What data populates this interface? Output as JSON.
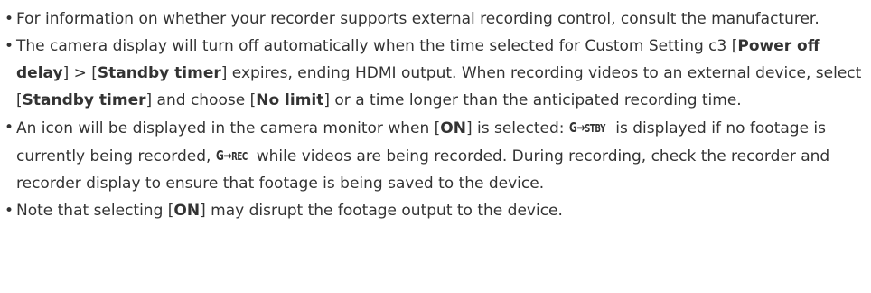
{
  "notes": [
    {
      "segments": [
        {
          "text": "For information on whether your recorder supports external recording control, consult the manufacturer."
        }
      ]
    },
    {
      "segments": [
        {
          "text": "The camera display will turn off automatically when the time selected for Custom Setting c3 ["
        },
        {
          "text": "Power off delay",
          "bold": true
        },
        {
          "text": "] > ["
        },
        {
          "text": "Standby timer",
          "bold": true
        },
        {
          "text": "] expires, ending HDMI output. When recording videos to an external device, select ["
        },
        {
          "text": "Standby timer",
          "bold": true
        },
        {
          "text": "] and choose ["
        },
        {
          "text": "No limit",
          "bold": true
        },
        {
          "text": "] or a time longer than the anticipated recording time."
        }
      ]
    },
    {
      "segments": [
        {
          "text": "An icon will be displayed in the camera monitor when ["
        },
        {
          "text": "ON",
          "bold": true
        },
        {
          "text": "] is selected: "
        },
        {
          "icon": "hdmi-standby-icon",
          "label": "STBY"
        },
        {
          "text": " is displayed if no footage is currently being recorded, "
        },
        {
          "icon": "hdmi-recording-icon",
          "label": "REC"
        },
        {
          "text": " while videos are being recorded. During recording, check the recorder and recorder display to ensure that footage is being saved to the device."
        }
      ]
    },
    {
      "segments": [
        {
          "text": "Note that selecting ["
        },
        {
          "text": "ON",
          "bold": true
        },
        {
          "text": "] may disrupt the footage output to the device."
        }
      ]
    }
  ],
  "bullet_glyph": "•",
  "icon_arrow_glyph": "G→"
}
